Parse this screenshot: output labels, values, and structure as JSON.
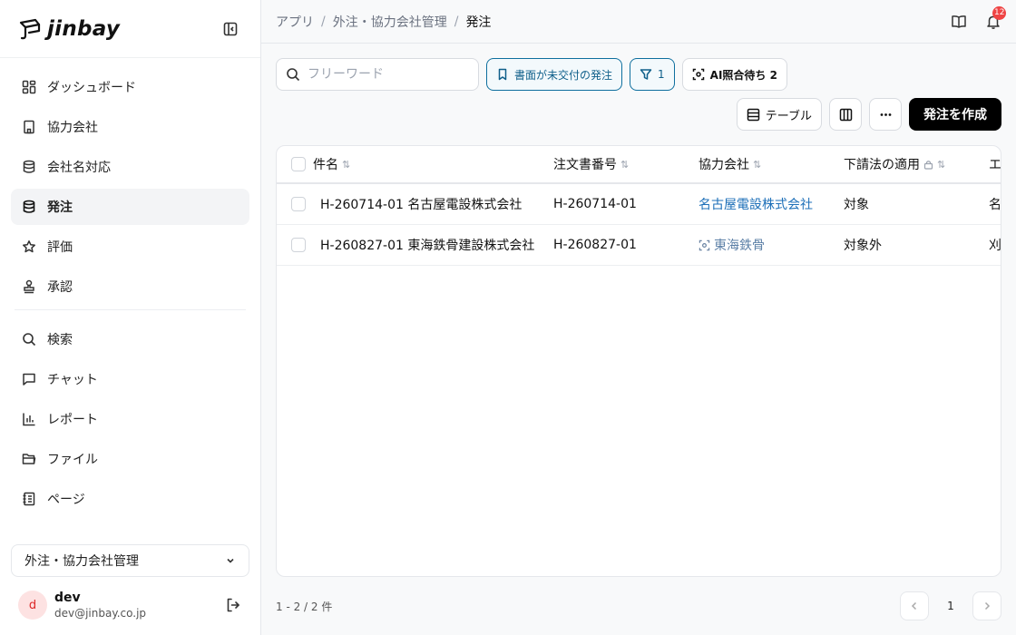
{
  "brand": {
    "name": "jinbay"
  },
  "sidebar": {
    "items": [
      {
        "label": "ダッシュボード",
        "icon": "dashboard-icon"
      },
      {
        "label": "協力会社",
        "icon": "building-icon"
      },
      {
        "label": "会社名対応",
        "icon": "database-icon"
      },
      {
        "label": "発注",
        "icon": "database-icon",
        "active": true
      },
      {
        "label": "評価",
        "icon": "star-icon"
      },
      {
        "label": "承認",
        "icon": "stamp-icon"
      },
      {
        "label": "検索",
        "icon": "search-icon"
      },
      {
        "label": "チャット",
        "icon": "chat-icon"
      },
      {
        "label": "レポート",
        "icon": "chart-icon"
      },
      {
        "label": "ファイル",
        "icon": "folder-icon"
      },
      {
        "label": "ページ",
        "icon": "notebook-icon"
      }
    ],
    "workspace": "外注・協力会社管理",
    "user": {
      "initial": "d",
      "name": "dev",
      "email": "dev@jinbay.co.jp"
    }
  },
  "breadcrumb": {
    "root": "アプリ",
    "section": "外注・協力会社管理",
    "current": "発注"
  },
  "notifications": {
    "count": "12"
  },
  "toolbar": {
    "search_placeholder": "フリーワード",
    "unissued_filter": "書面が未交付の発注",
    "filter_count": "1",
    "ai_pending": "AI照合待ち 2",
    "view_label": "テーブル",
    "create_label": "発注を作成"
  },
  "table": {
    "headers": {
      "name": "件名",
      "order_no": "注文書番号",
      "partner": "協力会社",
      "subcontract": "下請法の適用",
      "next": "エ"
    },
    "rows": [
      {
        "name": "H-260714-01 名古屋電設株式会社",
        "order_no": "H-260714-01",
        "partner": "名古屋電設株式会社",
        "subcontract": "対象",
        "next": "名"
      },
      {
        "name": "H-260827-01 東海鉄骨建設株式会社",
        "order_no": "H-260827-01",
        "partner": "東海鉄骨",
        "subcontract": "対象外",
        "next": "刈"
      }
    ]
  },
  "pagination": {
    "summary": "1 - 2 / 2 件",
    "page": "1"
  },
  "colors": {
    "accent": "#0f6f9e",
    "link": "#1d6fb8",
    "badge": "#ef4444",
    "primary": "#000000"
  }
}
